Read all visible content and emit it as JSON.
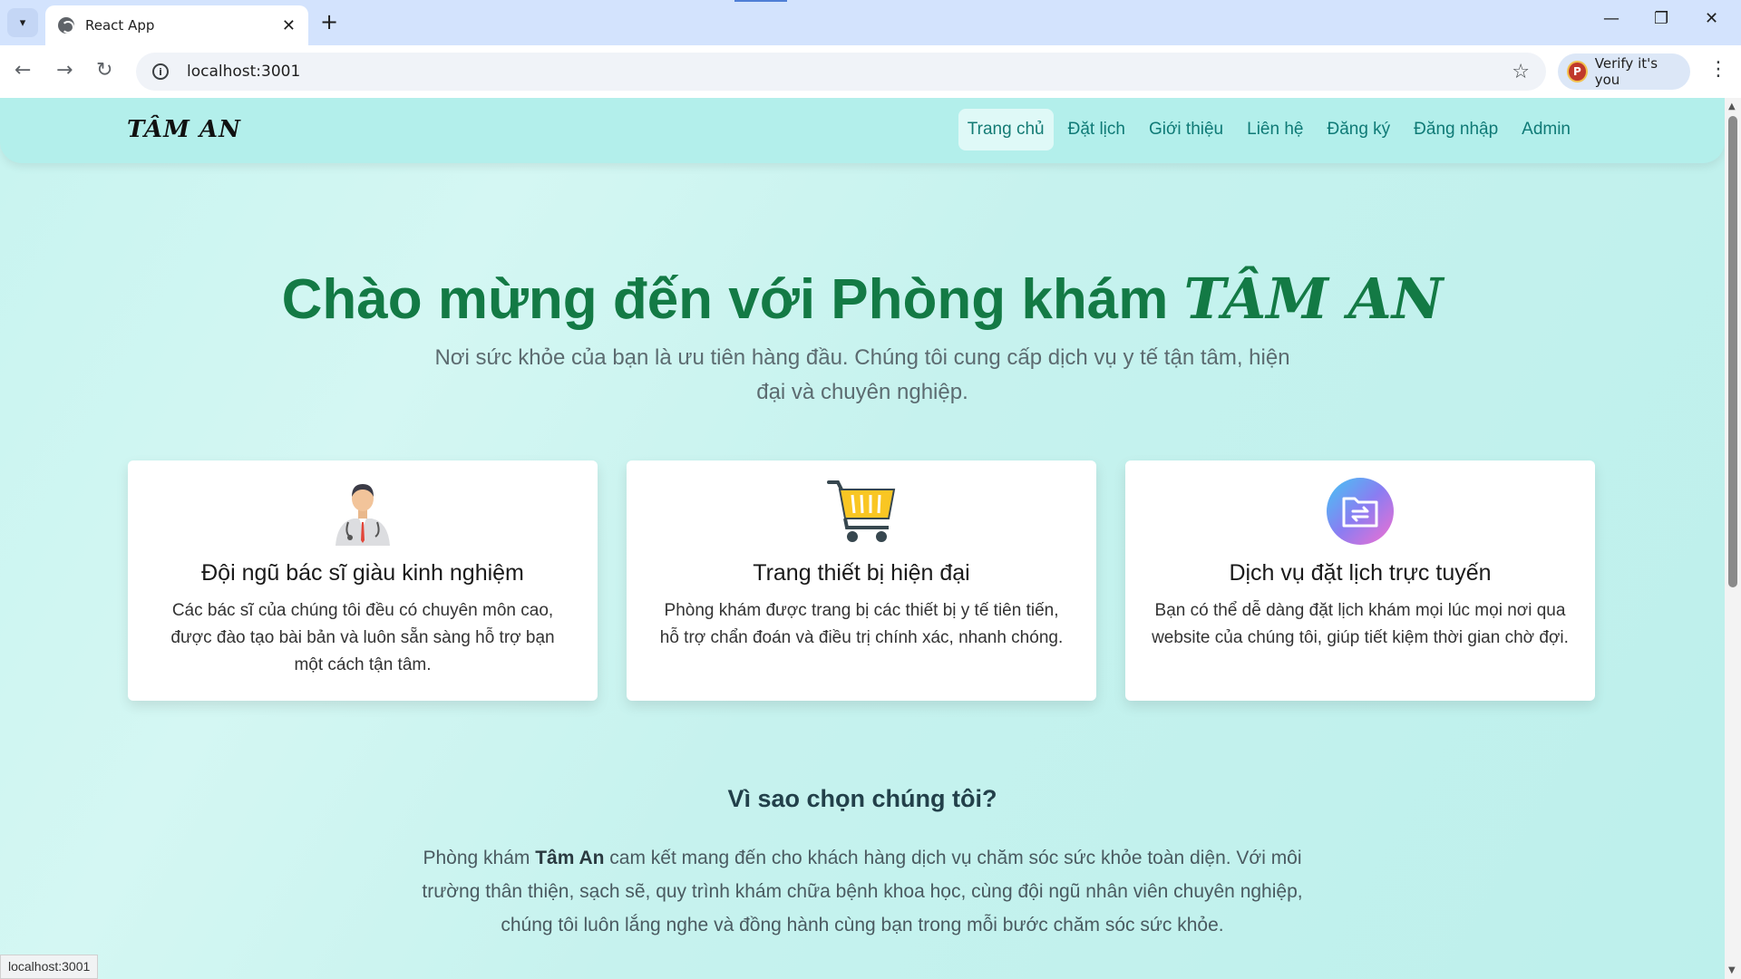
{
  "browser": {
    "tab_title": "React App",
    "url": "localhost:3001",
    "verify_label": "Verify it's you",
    "avatar_letter": "P",
    "status_url": "localhost:3001"
  },
  "navbar": {
    "logo": "TÂM AN",
    "items": [
      {
        "label": "Trang chủ",
        "active": true
      },
      {
        "label": "Đặt lịch"
      },
      {
        "label": "Giới thiệu"
      },
      {
        "label": "Liên hệ"
      },
      {
        "label": "Đăng ký"
      },
      {
        "label": "Đăng nhập"
      },
      {
        "label": "Admin"
      }
    ]
  },
  "hero": {
    "title_prefix": "Chào mừng đến với Phòng khám ",
    "title_brand": "TÂM AN",
    "subtitle": "Nơi sức khỏe của bạn là ưu tiên hàng đầu. Chúng tôi cung cấp dịch vụ y tế tận tâm, hiện đại và chuyên nghiệp."
  },
  "features": [
    {
      "icon": "doctor-icon",
      "title": "Đội ngũ bác sĩ giàu kinh nghiệm",
      "desc": "Các bác sĩ của chúng tôi đều có chuyên môn cao, được đào tạo bài bản và luôn sẵn sàng hỗ trợ bạn một cách tận tâm."
    },
    {
      "icon": "cart-icon",
      "title": "Trang thiết bị hiện đại",
      "desc": "Phòng khám được trang bị các thiết bị y tế tiên tiến, hỗ trợ chẩn đoán và điều trị chính xác, nhanh chóng."
    },
    {
      "icon": "folder-transfer-icon",
      "title": "Dịch vụ đặt lịch trực tuyến",
      "desc": "Bạn có thể dễ dàng đặt lịch khám mọi lúc mọi nơi qua website của chúng tôi, giúp tiết kiệm thời gian chờ đợi."
    }
  ],
  "why": {
    "title": "Vì sao chọn chúng tôi?",
    "text_before": "Phòng khám ",
    "text_bold": "Tâm An",
    "text_after": " cam kết mang đến cho khách hàng dịch vụ chăm sóc sức khỏe toàn diện. Với môi trường thân thiện, sạch sẽ, quy trình khám chữa bệnh khoa học, cùng đội ngũ nhân viên chuyên nghiệp, chúng tôi luôn lắng nghe và đồng hành cùng bạn trong mỗi bước chăm sóc sức khỏe."
  }
}
